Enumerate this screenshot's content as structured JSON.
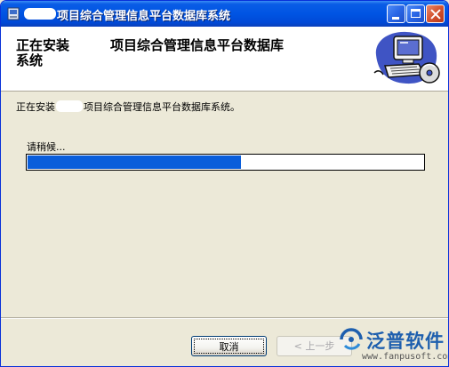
{
  "window": {
    "title": "项目综合管理信息平台数据库系统",
    "title_icon": "installer-icon",
    "controls": [
      "minimize-icon",
      "maximize-icon",
      "close-icon"
    ]
  },
  "header": {
    "line1_prefix": "正在安装",
    "line1_suffix": "项目综合管理信息平台数据库",
    "line2": "系统",
    "graphic": "computer-setup-icon"
  },
  "body": {
    "intro_prefix": "正在安装",
    "intro_suffix": "项目综合管理信息平台数据库系统。",
    "status": "请稍候...",
    "progress_fraction": 0.54
  },
  "buttons": {
    "cancel": "取消",
    "back": "< 上一步"
  },
  "watermark": {
    "brand": "泛普软件",
    "url": "www.fanpusoft.com"
  },
  "colors": {
    "titlebar": "#0054e3",
    "progress": "#0a5edb",
    "dialog_bg": "#ece9d8",
    "brand": "#1e5fae"
  }
}
